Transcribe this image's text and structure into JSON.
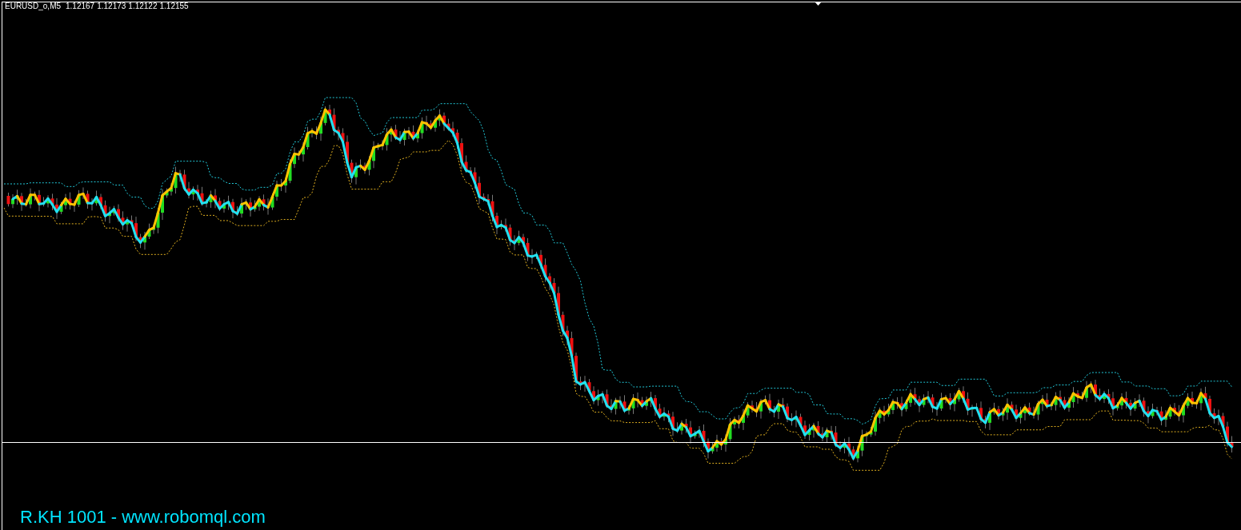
{
  "header": {
    "symbol": "EURUSD_o,M5",
    "prices": [
      "1.12167",
      "1.12173",
      "1.12122",
      "1.12155"
    ]
  },
  "label": "R.KH 1001 - www.robomql.com"
}
